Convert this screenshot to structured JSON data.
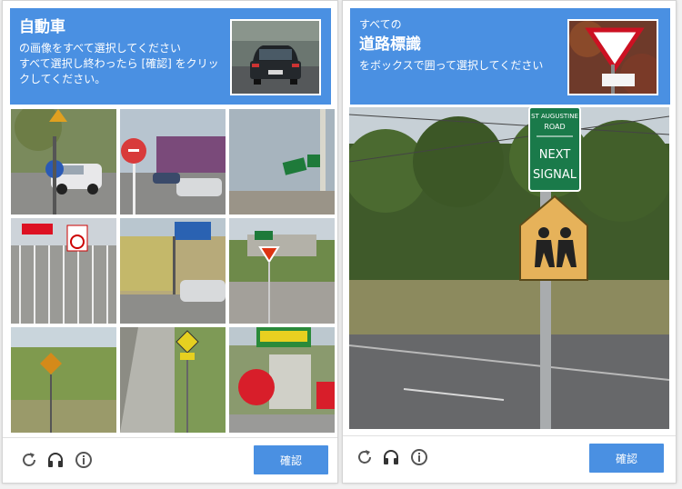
{
  "left": {
    "title": "自動車",
    "instruction_1": "の画像をすべて選択してください",
    "instruction_2": "すべて選択し終わったら [確認] をクリックしてください。",
    "tiles": [
      {
        "name": "tile-1"
      },
      {
        "name": "tile-2"
      },
      {
        "name": "tile-3"
      },
      {
        "name": "tile-4"
      },
      {
        "name": "tile-5"
      },
      {
        "name": "tile-6"
      },
      {
        "name": "tile-7"
      },
      {
        "name": "tile-8"
      },
      {
        "name": "tile-9"
      }
    ],
    "verify_label": "確認"
  },
  "right": {
    "prefix": "すべての",
    "title": "道路標識",
    "instruction": "をボックスで囲って選択してください",
    "verify_label": "確認",
    "sign_top_text_1": "ST AUGUSTINE",
    "sign_top_text_2": "ROAD",
    "sign_top_text_3": "NEXT",
    "sign_top_text_4": "SIGNAL"
  },
  "icons": {
    "reload": "reload-icon",
    "audio": "headphones-icon",
    "info": "info-icon"
  },
  "colors": {
    "accent": "#4a90e2"
  }
}
